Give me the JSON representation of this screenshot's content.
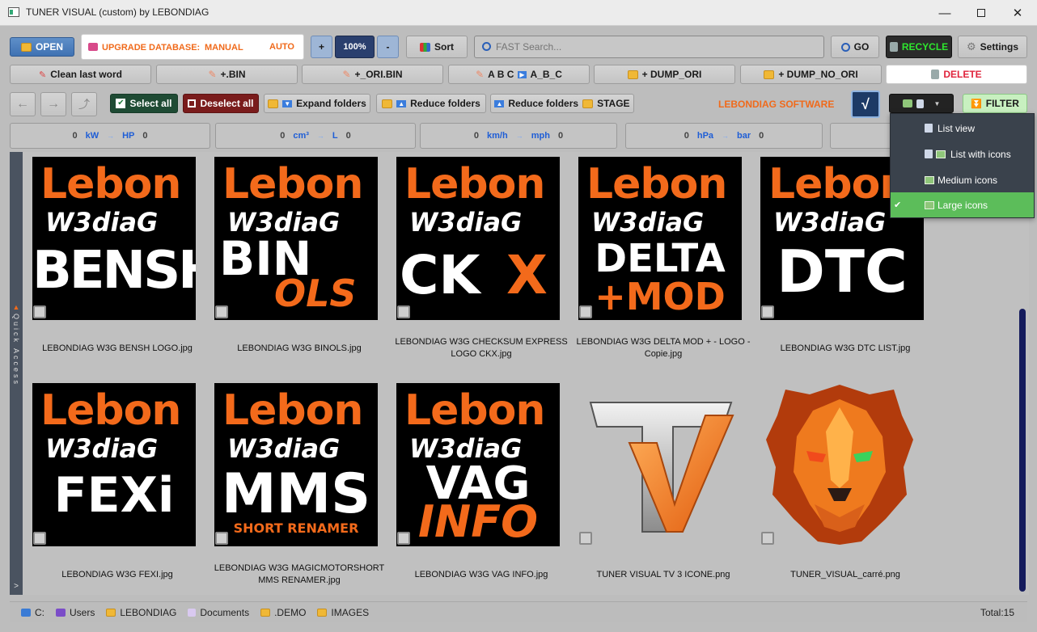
{
  "window": {
    "title": "TUNER VISUAL (custom) by LEBONDIAG"
  },
  "toolbar1": {
    "open": "OPEN",
    "upgrade_label": "UPGRADE DATABASE:",
    "manual": "MANUAL",
    "auto": "AUTO",
    "zoom_plus": "+",
    "zoom_value": "100%",
    "zoom_minus": "-",
    "sort": "Sort",
    "search_placeholder": "FAST Search...",
    "go": "GO",
    "recycle": "RECYCLE",
    "settings": "Settings"
  },
  "toolbar2": {
    "clean": "Clean last word",
    "bin": "+.BIN",
    "ori_bin": "+_ORI.BIN",
    "abc_pre": "A B C",
    "abc_post": "A_B_C",
    "dump_ori": "+ DUMP_ORI",
    "dump_no_ori": "+ DUMP_NO_ORI",
    "delete": "DELETE"
  },
  "toolbar3": {
    "back": "←",
    "forward": "→",
    "up": "⤴",
    "select_all": "Select all",
    "deselect_all": "Deselect all",
    "expand": "Expand folders",
    "reduce": "Reduce folders",
    "reduce_stage_pre": "Reduce folders",
    "reduce_stage_post": "STAGE",
    "brand": "LEBONDIAG SOFTWARE",
    "check": "√",
    "filter": "FILTER"
  },
  "converters": [
    {
      "left": "0",
      "u1": "kW",
      "u2": "HP",
      "right": "0"
    },
    {
      "left": "0",
      "u1": "cm³",
      "u2": "L",
      "right": "0"
    },
    {
      "left": "0",
      "u1": "km/h",
      "u2": "mph",
      "right": "0"
    },
    {
      "left": "0",
      "u1": "hPa",
      "u2": "bar",
      "right": "0"
    }
  ],
  "sidebar": {
    "label": "Quick Access",
    "expander": ">"
  },
  "view_menu": {
    "items": [
      "List view",
      "List with icons",
      "Medium icons",
      "Large icons"
    ],
    "selected": "Large icons",
    "check_glyph": "✔"
  },
  "thumbs": {
    "brand1": "Lebon",
    "brand2": "W3diaG",
    "t1": "BENSH",
    "t2a": "BIN",
    "t2b": "OLS",
    "t3a": "CK",
    "t3b": "X",
    "t4a": "DELTA",
    "t4b": "+MOD",
    "t5": "DTC",
    "t6": "FEXi",
    "t7a": "MMS",
    "t7b": "SHORT RENAMER",
    "t8a": "VAG",
    "t8b": "INFO"
  },
  "files": [
    "LEBONDIAG W3G BENSH LOGO.jpg",
    "LEBONDIAG W3G BINOLS.jpg",
    "LEBONDIAG W3G CHECKSUM EXPRESS LOGO CKX.jpg",
    "LEBONDIAG W3G DELTA MOD + - LOGO - Copie.jpg",
    "LEBONDIAG W3G DTC LIST.jpg",
    "LEBONDIAG W3G FEXI.jpg",
    "LEBONDIAG W3G MAGICMOTORSHORT MMS RENAMER.jpg",
    "LEBONDIAG W3G VAG INFO.jpg",
    "TUNER VISUAL TV 3 ICONE.png",
    "TUNER_VISUAL_carré.png"
  ],
  "breadcrumb": [
    "C:",
    "Users",
    "LEBONDIAG",
    "Documents",
    ".DEMO",
    "IMAGES"
  ],
  "total": "Total:15"
}
